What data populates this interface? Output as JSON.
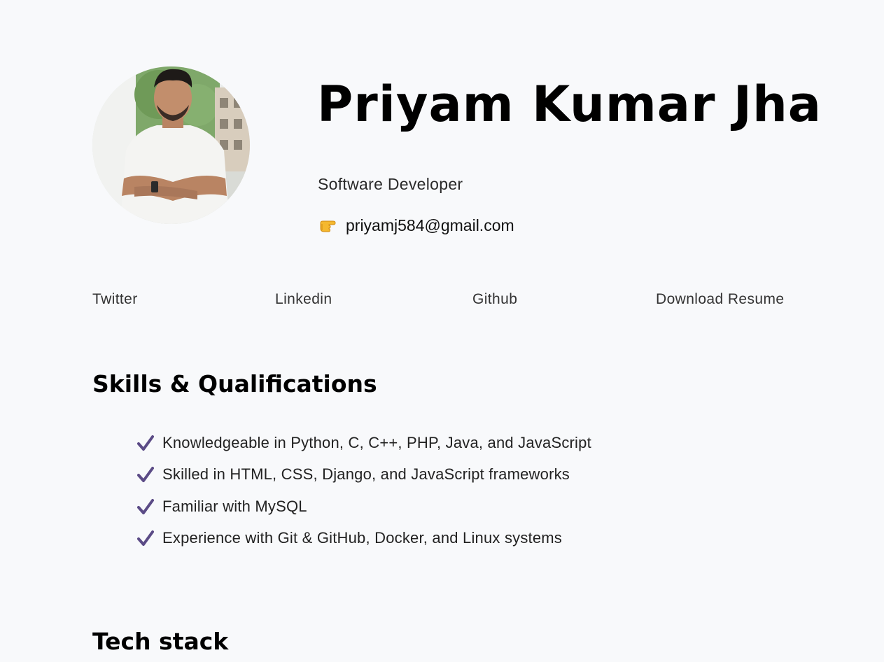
{
  "profile": {
    "name": "Priyam Kumar Jha",
    "role": "Software Developer",
    "email": "priyamj584@gmail.com",
    "email_icon": "pointing-hand-icon"
  },
  "links": {
    "twitter": "Twitter",
    "linkedin": "Linkedin",
    "github": "Github",
    "resume": "Download Resume"
  },
  "skills": {
    "title": "Skills & Qualifications",
    "icon": "checkmark-icon",
    "items": [
      "Knowledgeable in Python, C, C++, PHP, Java, and JavaScript",
      "Skilled in HTML, CSS, Django, and JavaScript frameworks",
      "Familiar with MySQL",
      "Experience with Git & GitHub, Docker, and Linux systems"
    ]
  },
  "tech": {
    "title": "Tech stack"
  },
  "colors": {
    "background": "#f8f9fb",
    "check": "#5b4b86",
    "text": "#111111"
  }
}
